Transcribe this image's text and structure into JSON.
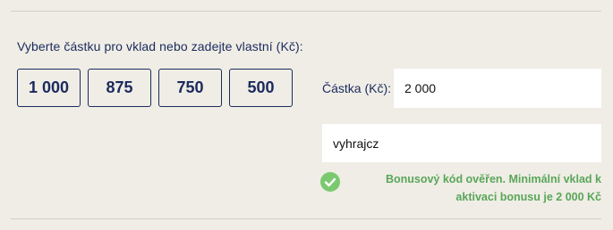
{
  "deposit": {
    "prompt": "Vyberte částku pro vklad nebo zadejte vlastní (Kč):",
    "preset_amounts": [
      "1 000",
      "875",
      "750",
      "500"
    ],
    "amount_label": "Částka (Kč):",
    "amount_value": "2 000",
    "bonus_code_value": "vyhrajcz",
    "bonus_message": "Bonusový kód ověřen. Minimální vklad k aktivaci bonusu je 2 000 Kč"
  },
  "colors": {
    "background": "#efede5",
    "text_primary": "#1b2a5e",
    "success": "#5aa65a",
    "success_icon": "#7bc96f"
  }
}
